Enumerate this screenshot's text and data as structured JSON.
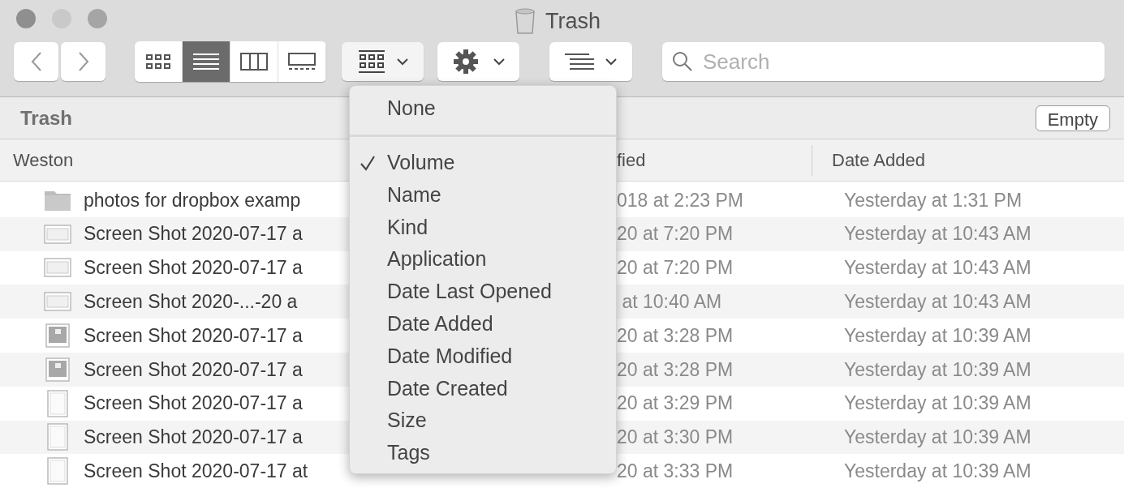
{
  "window": {
    "title": "Trash"
  },
  "toolbar": {
    "view_buttons": [
      {
        "kind": "icons",
        "selected": false
      },
      {
        "kind": "list",
        "selected": true
      },
      {
        "kind": "columns",
        "selected": false
      },
      {
        "kind": "gallery",
        "selected": false
      }
    ],
    "search": {
      "placeholder": "Search"
    }
  },
  "path_bar": {
    "title": "Trash",
    "button": "Empty"
  },
  "table": {
    "columns": [
      "Weston",
      "fied",
      "Date Added"
    ],
    "rows": [
      {
        "kind": "folder",
        "name": "photos for dropbox examp",
        "modified": "018 at 2:23 PM",
        "added": "Yesterday at 1:31 PM"
      },
      {
        "kind": "wide",
        "name": "Screen Shot 2020-07-17 a",
        "modified": "20 at 7:20 PM",
        "added": "Yesterday at 10:43 AM"
      },
      {
        "kind": "wide",
        "name": "Screen Shot 2020-07-17 a",
        "modified": "20 at 7:20 PM",
        "added": "Yesterday at 10:43 AM"
      },
      {
        "kind": "wide",
        "name": "Screen Shot 2020-...-20 a",
        "modified": " at 10:40 AM",
        "added": "Yesterday at 10:43 AM"
      },
      {
        "kind": "dark",
        "name": "Screen Shot 2020-07-17 a",
        "modified": "20 at 3:28 PM",
        "added": "Yesterday at 10:39 AM"
      },
      {
        "kind": "dark",
        "name": "Screen Shot 2020-07-17 a",
        "modified": "20 at 3:28 PM",
        "added": "Yesterday at 10:39 AM"
      },
      {
        "kind": "tall",
        "name": "Screen Shot 2020-07-17 a",
        "modified": "20 at 3:29 PM",
        "added": "Yesterday at 10:39 AM"
      },
      {
        "kind": "tall",
        "name": "Screen Shot 2020-07-17 a",
        "modified": "20 at 3:30 PM",
        "added": "Yesterday at 10:39 AM"
      },
      {
        "kind": "tall",
        "name": "Screen Shot 2020-07-17 at",
        "modified": "20 at 3:33 PM",
        "added": "Yesterday at 10:39 AM"
      }
    ]
  },
  "group_menu": [
    {
      "kind": "item",
      "label": "None",
      "checked": false
    },
    {
      "kind": "separator"
    },
    {
      "kind": "item",
      "label": "Volume",
      "checked": true
    },
    {
      "kind": "item",
      "label": "Name",
      "checked": false
    },
    {
      "kind": "item",
      "label": "Kind",
      "checked": false
    },
    {
      "kind": "item",
      "label": "Application",
      "checked": false
    },
    {
      "kind": "item",
      "label": "Date Last Opened",
      "checked": false
    },
    {
      "kind": "item",
      "label": "Date Added",
      "checked": false
    },
    {
      "kind": "item",
      "label": "Date Modified",
      "checked": false
    },
    {
      "kind": "item",
      "label": "Date Created",
      "checked": false
    },
    {
      "kind": "item",
      "label": "Size",
      "checked": false
    },
    {
      "kind": "item",
      "label": "Tags",
      "checked": false
    }
  ]
}
